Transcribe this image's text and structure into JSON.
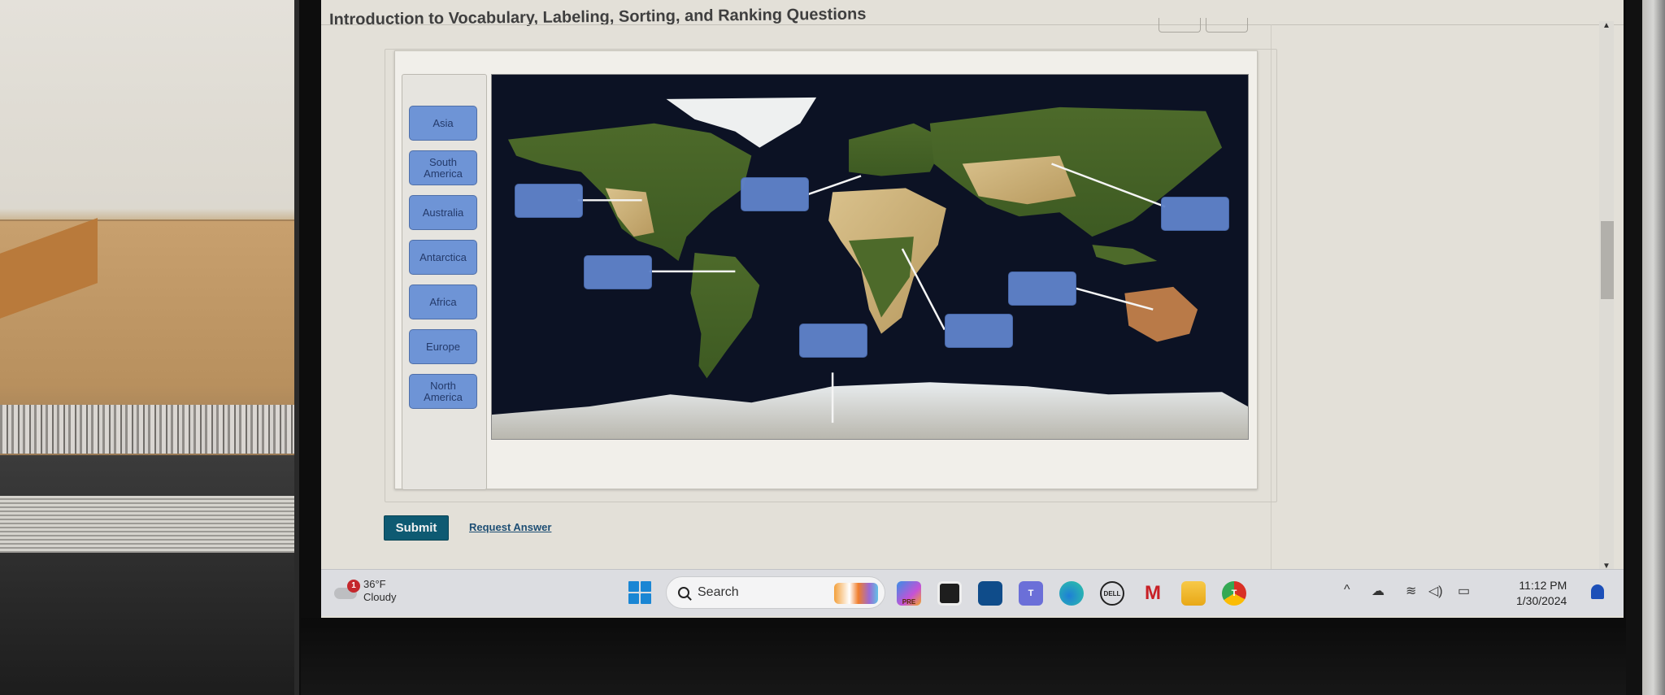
{
  "page": {
    "title": "Introduction to Vocabulary, Labeling, Sorting, and Ranking Questions"
  },
  "activity": {
    "label_bank": [
      {
        "label": "Asia"
      },
      {
        "label": "South America"
      },
      {
        "label": "Australia"
      },
      {
        "label": "Antarctica"
      },
      {
        "label": "Africa"
      },
      {
        "label": "Europe"
      },
      {
        "label": "North America"
      }
    ],
    "map_description": "World satellite map",
    "drop_targets": [
      {
        "id": "target-north-america",
        "value": ""
      },
      {
        "id": "target-europe",
        "value": ""
      },
      {
        "id": "target-asia",
        "value": ""
      },
      {
        "id": "target-south-america",
        "value": ""
      },
      {
        "id": "target-australia",
        "value": ""
      },
      {
        "id": "target-africa",
        "value": ""
      },
      {
        "id": "target-antarctica",
        "value": ""
      }
    ],
    "colors": {
      "label_fill": "#6e94d6",
      "target_fill": "#5f82c9",
      "ocean": "#0c1224"
    }
  },
  "actions": {
    "submit_label": "Submit",
    "request_answer_label": "Request Answer",
    "submit_color": "#0e5a72"
  },
  "taskbar": {
    "weather": {
      "temp": "36°F",
      "condition": "Cloudy",
      "badge": "1"
    },
    "search_placeholder": "Search",
    "apps": [
      {
        "name": "copilot",
        "label": "PRE"
      },
      {
        "name": "terminal",
        "label": ""
      },
      {
        "name": "microsoft-store",
        "label": ""
      },
      {
        "name": "teams",
        "label": "T"
      },
      {
        "name": "edge",
        "label": ""
      },
      {
        "name": "dell",
        "label": "DELL"
      },
      {
        "name": "mcafee",
        "label": "M"
      },
      {
        "name": "file-explorer",
        "label": ""
      },
      {
        "name": "chrome",
        "label": "T"
      }
    ],
    "clock": {
      "time": "11:12 PM",
      "date": "1/30/2024"
    }
  }
}
